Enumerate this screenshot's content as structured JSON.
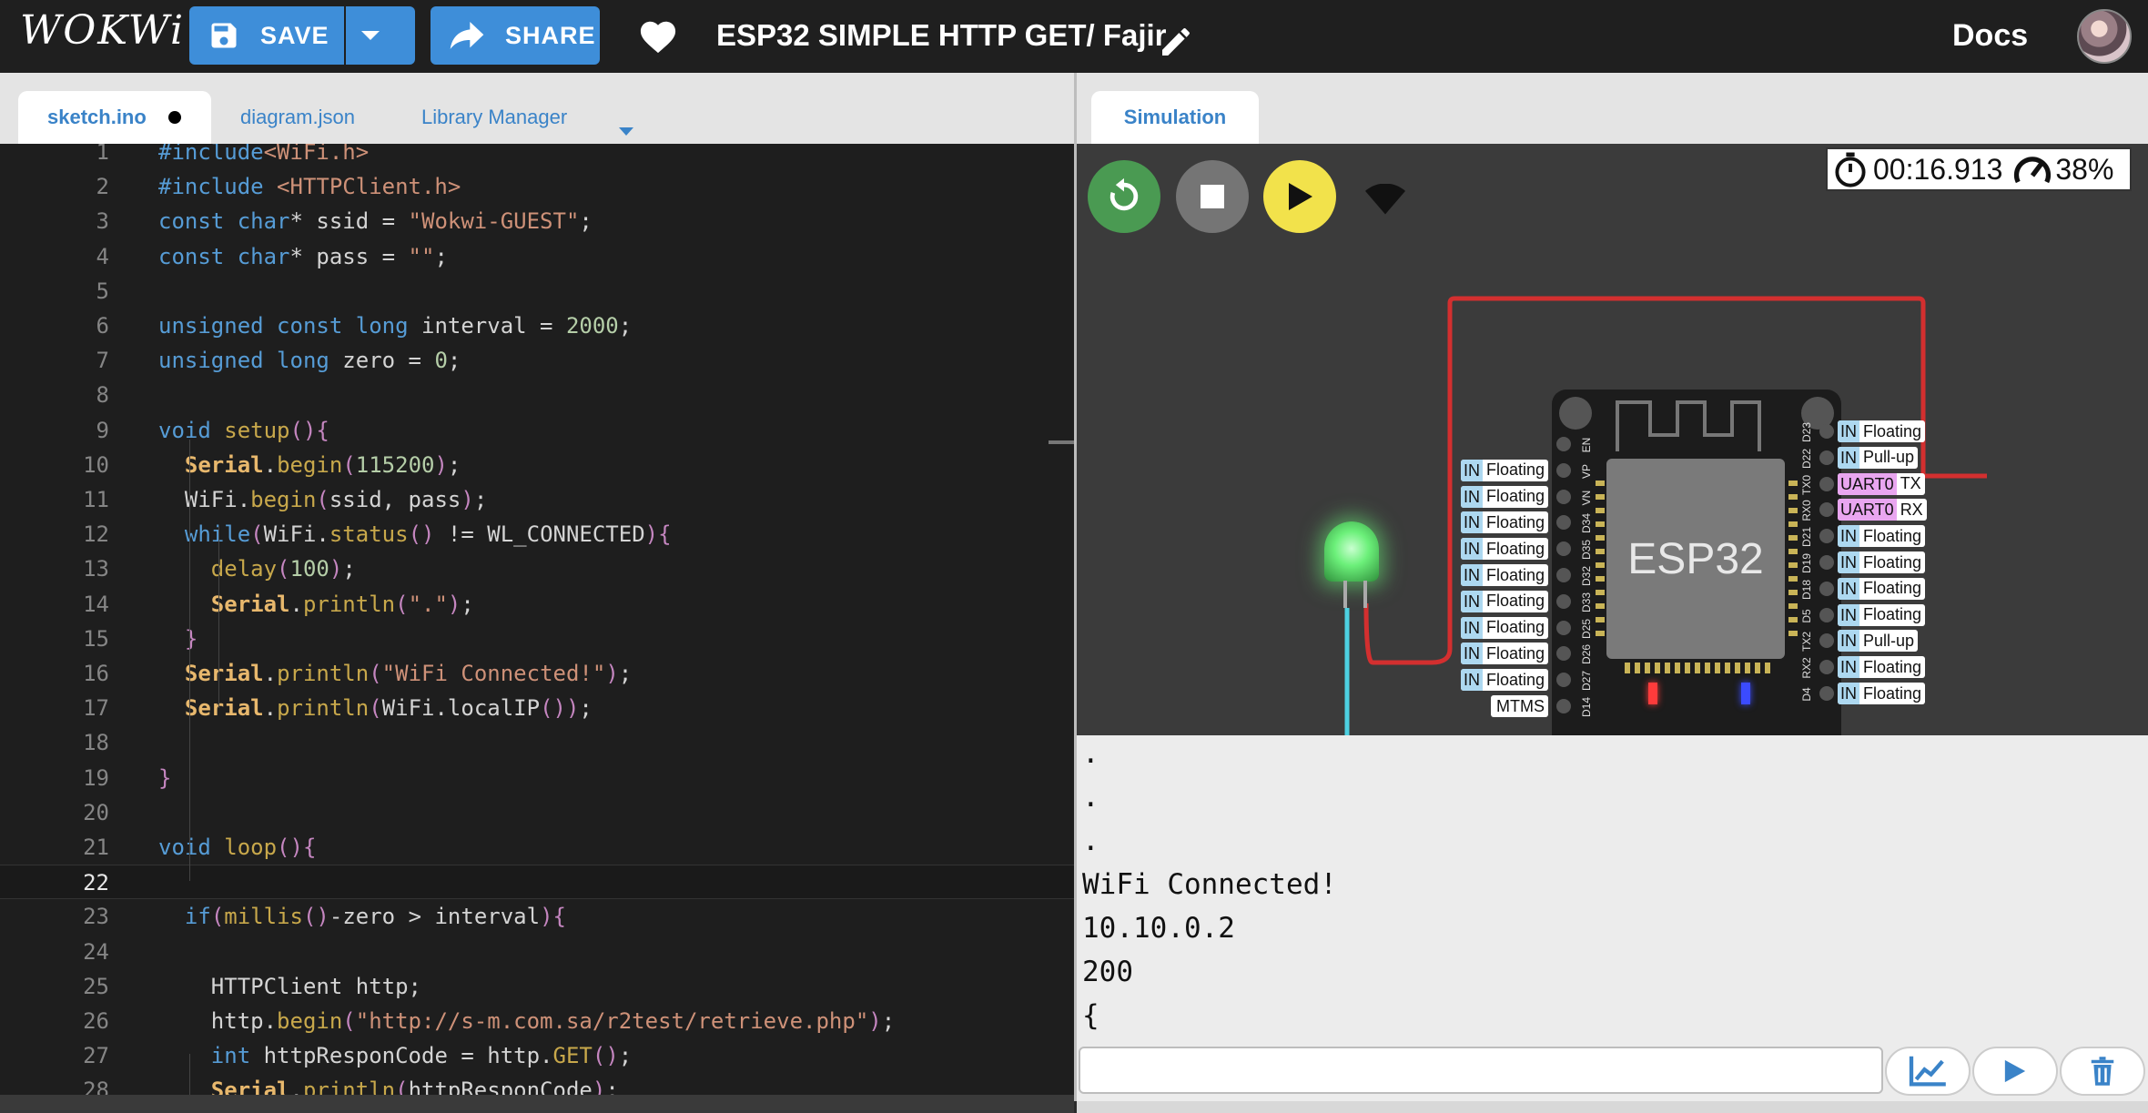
{
  "header": {
    "logo": "WOKWi",
    "save_label": "SAVE",
    "share_label": "SHARE",
    "project_title": "ESP32 SIMPLE HTTP GET/ Fajir",
    "docs_label": "Docs"
  },
  "editor_tabs": [
    {
      "label": "sketch.ino"
    },
    {
      "label": "diagram.json"
    },
    {
      "label": "Library Manager"
    }
  ],
  "code_lines": [
    {
      "n": "1",
      "text": "#include<WiFi.h>"
    },
    {
      "n": "2",
      "text": "#include <HTTPClient.h>"
    },
    {
      "n": "3",
      "text": "const char* ssid = \"Wokwi-GUEST\";"
    },
    {
      "n": "4",
      "text": "const char* pass = \"\";"
    },
    {
      "n": "5",
      "text": ""
    },
    {
      "n": "6",
      "text": "unsigned const long interval = 2000;"
    },
    {
      "n": "7",
      "text": "unsigned long zero = 0;"
    },
    {
      "n": "8",
      "text": ""
    },
    {
      "n": "9",
      "text": "void setup(){"
    },
    {
      "n": "10",
      "text": "  Serial.begin(115200);"
    },
    {
      "n": "11",
      "text": "  WiFi.begin(ssid, pass);"
    },
    {
      "n": "12",
      "text": "  while(WiFi.status() != WL_CONNECTED){"
    },
    {
      "n": "13",
      "text": "    delay(100);"
    },
    {
      "n": "14",
      "text": "    Serial.println(\".\");"
    },
    {
      "n": "15",
      "text": "  }"
    },
    {
      "n": "16",
      "text": "  Serial.println(\"WiFi Connected!\");"
    },
    {
      "n": "17",
      "text": "  Serial.println(WiFi.localIP());"
    },
    {
      "n": "18",
      "text": ""
    },
    {
      "n": "19",
      "text": "}"
    },
    {
      "n": "20",
      "text": ""
    },
    {
      "n": "21",
      "text": "void loop(){"
    },
    {
      "n": "22",
      "text": ""
    },
    {
      "n": "23",
      "text": "  if(millis()-zero > interval){"
    },
    {
      "n": "24",
      "text": ""
    },
    {
      "n": "25",
      "text": "    HTTPClient http;"
    },
    {
      "n": "26",
      "text": "    http.begin(\"http://s-m.com.sa/r2test/retrieve.php\");"
    },
    {
      "n": "27",
      "text": "    int httpResponCode = http.GET();"
    },
    {
      "n": "28",
      "text": "    Serial.println(httpResponCode);"
    }
  ],
  "simulation": {
    "tab_label": "Simulation",
    "timer": "00:16.913",
    "speed": "38%",
    "chip_label": "ESP32",
    "left_pins": [
      {
        "code": "EN",
        "mode": "",
        "label": ""
      },
      {
        "code": "VP",
        "mode": "IN",
        "label": "Floating"
      },
      {
        "code": "VN",
        "mode": "IN",
        "label": "Floating"
      },
      {
        "code": "D34",
        "mode": "IN",
        "label": "Floating"
      },
      {
        "code": "D35",
        "mode": "IN",
        "label": "Floating"
      },
      {
        "code": "D32",
        "mode": "IN",
        "label": "Floating"
      },
      {
        "code": "D33",
        "mode": "IN",
        "label": "Floating"
      },
      {
        "code": "D25",
        "mode": "IN",
        "label": "Floating"
      },
      {
        "code": "D26",
        "mode": "IN",
        "label": "Floating"
      },
      {
        "code": "D27",
        "mode": "IN",
        "label": "Floating"
      },
      {
        "code": "D14",
        "mode": "",
        "label": "MTMS"
      }
    ],
    "right_pins": [
      {
        "code": "D23",
        "mode": "IN",
        "label": "Floating"
      },
      {
        "code": "D22",
        "mode": "IN",
        "label": "Pull-up"
      },
      {
        "code": "TX0",
        "mode": "UART0",
        "label": "TX"
      },
      {
        "code": "RX0",
        "mode": "UART0",
        "label": "RX"
      },
      {
        "code": "D21",
        "mode": "IN",
        "label": "Floating"
      },
      {
        "code": "D19",
        "mode": "IN",
        "label": "Floating"
      },
      {
        "code": "D18",
        "mode": "IN",
        "label": "Floating"
      },
      {
        "code": "D5",
        "mode": "IN",
        "label": "Floating"
      },
      {
        "code": "TX2",
        "mode": "IN",
        "label": "Pull-up"
      },
      {
        "code": "RX2",
        "mode": "IN",
        "label": "Floating"
      },
      {
        "code": "D4",
        "mode": "IN",
        "label": "Floating"
      }
    ]
  },
  "serial_output": [
    ".",
    ".",
    ".",
    "WiFi Connected!",
    "10.10.0.2",
    "200",
    "{"
  ],
  "serial_input": {
    "value": ""
  },
  "colors": {
    "accent": "#3e8ed9",
    "keyword": "#569cd6",
    "string": "#ce9178",
    "function": "#c8a84b",
    "serial": "#e8b86d",
    "wire_red": "#d32f2f",
    "wire_cyan": "#4dd0e1",
    "led_green": "#6cf07a"
  }
}
